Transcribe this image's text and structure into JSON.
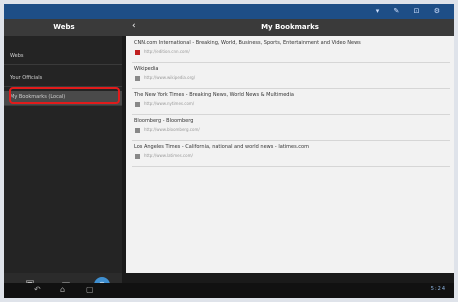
{
  "header": {
    "left_title": "Webs",
    "back_glyph": "‹",
    "right_title": "My Bookmarks"
  },
  "sidebar": {
    "items": [
      {
        "label": "Webs"
      },
      {
        "label": "Your Officials"
      },
      {
        "label": "My Bookmarks (Local)"
      }
    ]
  },
  "bookmarks": [
    {
      "title": "CNN.com International - Breaking, World, Business, Sports, Entertainment and Video News",
      "url": "http://edition.cnn.com/",
      "icon": "cnn-favicon"
    },
    {
      "title": "Wikipedia",
      "url": "http://www.wikipedia.org/",
      "icon": "wikipedia-favicon"
    },
    {
      "title": "The New York Times - Breaking News, World News & Multimedia",
      "url": "http://www.nytimes.com/",
      "icon": "nyt-favicon"
    },
    {
      "title": "Bloomberg - Bloomberg",
      "url": "http://www.bloomberg.com/",
      "icon": "bloomberg-favicon"
    },
    {
      "title": "Los Angeles Times - California, national and world news - latimes.com",
      "url": "http://www.latimes.com/",
      "icon": "latimes-favicon"
    }
  ],
  "clock": "5:24",
  "colors": {
    "highlight": "#e21b1b",
    "statusbar": "#1e4e86"
  }
}
